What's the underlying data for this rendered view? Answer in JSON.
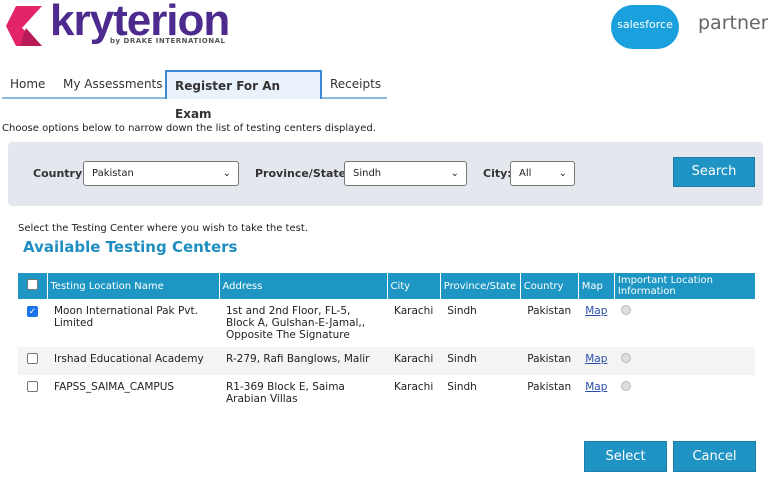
{
  "brand": {
    "name": "kryterion",
    "tagline": "by DRAKE INTERNATIONAL",
    "partner_logo": "salesforce",
    "partner_label": "partner"
  },
  "tabs": [
    {
      "label": "Home"
    },
    {
      "label": "My Assessments"
    },
    {
      "label": "Register For An Exam",
      "active": true
    },
    {
      "label": "Receipts"
    }
  ],
  "instructions": "Choose options below to narrow down the list of testing centers displayed.",
  "filter": {
    "country_label": "Country:",
    "country": "Pakistan",
    "province_label": "Province/State:",
    "province": "Sindh",
    "city_label": "City:",
    "city": "All",
    "search_label": "Search"
  },
  "select_prompt": "Select the Testing Center where you wish to take the test.",
  "section_title": "Available Testing Centers",
  "table": {
    "headers": [
      "Testing Location Name",
      "Address",
      "City",
      "Province/State",
      "Country",
      "Map",
      "Important Location Information"
    ],
    "rows": [
      {
        "checked": true,
        "name": "Moon International Pak Pvt. Limited",
        "address": "1st and 2nd Floor, FL-5, Block A, Gulshan-E-Jamal,, Opposite The Signature",
        "city": "Karachi",
        "province": "Sindh",
        "country": "Pakistan",
        "map": "Map"
      },
      {
        "checked": false,
        "name": "Irshad Educational Academy",
        "address": "R-279, Rafi Banglows, Malir",
        "city": "Karachi",
        "province": "Sindh",
        "country": "Pakistan",
        "map": "Map"
      },
      {
        "checked": false,
        "name": "FAPSS_SAIMA_CAMPUS",
        "address": "R1-369 Block E, Saima Arabian Villas",
        "city": "Karachi",
        "province": "Sindh",
        "country": "Pakistan",
        "map": "Map"
      }
    ]
  },
  "actions": {
    "select": "Select",
    "cancel": "Cancel"
  }
}
